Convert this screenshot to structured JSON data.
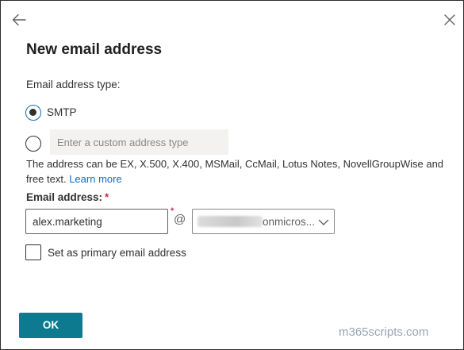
{
  "panel": {
    "title": "New email address",
    "back_icon": "arrow-left-icon",
    "close_icon": "close-icon"
  },
  "address_type": {
    "label": "Email address type:",
    "smtp_label": "SMTP",
    "smtp_selected": true,
    "custom_placeholder": "Enter a custom address type",
    "custom_value": ""
  },
  "help": {
    "text": "The address can be EX, X.500, X.400, MSMail, CcMail, Lotus Notes, NovellGroupWise and free text.",
    "link": "Learn more"
  },
  "email_address": {
    "label": "Email address:",
    "required_mark": "*",
    "local_value": "alex.marketing",
    "at": "@",
    "domain_value_visible": "onmicros...",
    "dropdown_icon": "chevron-down-icon"
  },
  "primary": {
    "label": "Set as primary email address",
    "checked": false
  },
  "actions": {
    "ok_label": "OK"
  },
  "watermark": "m365scripts.com",
  "colors": {
    "accent": "#0e7a8f",
    "link": "#0f6cbd",
    "required": "#c4314b"
  }
}
